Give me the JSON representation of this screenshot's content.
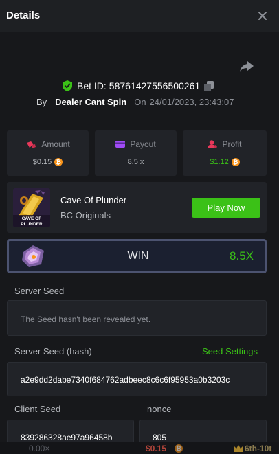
{
  "header": {
    "title": "Details"
  },
  "bet": {
    "id_label": "Bet ID:",
    "id_value": "58761427556500261",
    "by_label": "By",
    "user": "Dealer Cant Spin",
    "on_label": "On",
    "date": "24/01/2023, 23:43:07"
  },
  "stats": {
    "amount": {
      "label": "Amount",
      "value": "$0.15",
      "icon": "money-bag-icon"
    },
    "payout": {
      "label": "Payout",
      "value": "8.5 x",
      "icon": "wallet-icon"
    },
    "profit": {
      "label": "Profit",
      "value": "$1.12",
      "icon": "user-profit-icon"
    }
  },
  "game": {
    "name": "Cave Of Plunder",
    "provider": "BC Originals",
    "thumb_text": "CAVE OF PLUNDER",
    "play_label": "Play Now"
  },
  "result": {
    "label": "WIN",
    "multiplier": "8.5X"
  },
  "seeds": {
    "server_seed_label": "Server Seed",
    "server_seed_value": "The Seed hasn't been revealed yet.",
    "server_hash_label": "Server Seed (hash)",
    "seed_settings_label": "Seed Settings",
    "server_hash_value": "a2e9dd2dabe7340f684762adbeec8c6c6f95953a0b3203c",
    "client_seed_label": "Client Seed",
    "client_seed_value": "839286328ae97a96458b",
    "nonce_label": "nonce",
    "nonce_value": "805"
  },
  "bottom": {
    "left": "0.00×",
    "center": "$0.15",
    "right": "6th-10t"
  },
  "colors": {
    "accent_green": "#3bc117",
    "bg": "#17181b",
    "card": "#212328",
    "coin": "#f7931a"
  }
}
